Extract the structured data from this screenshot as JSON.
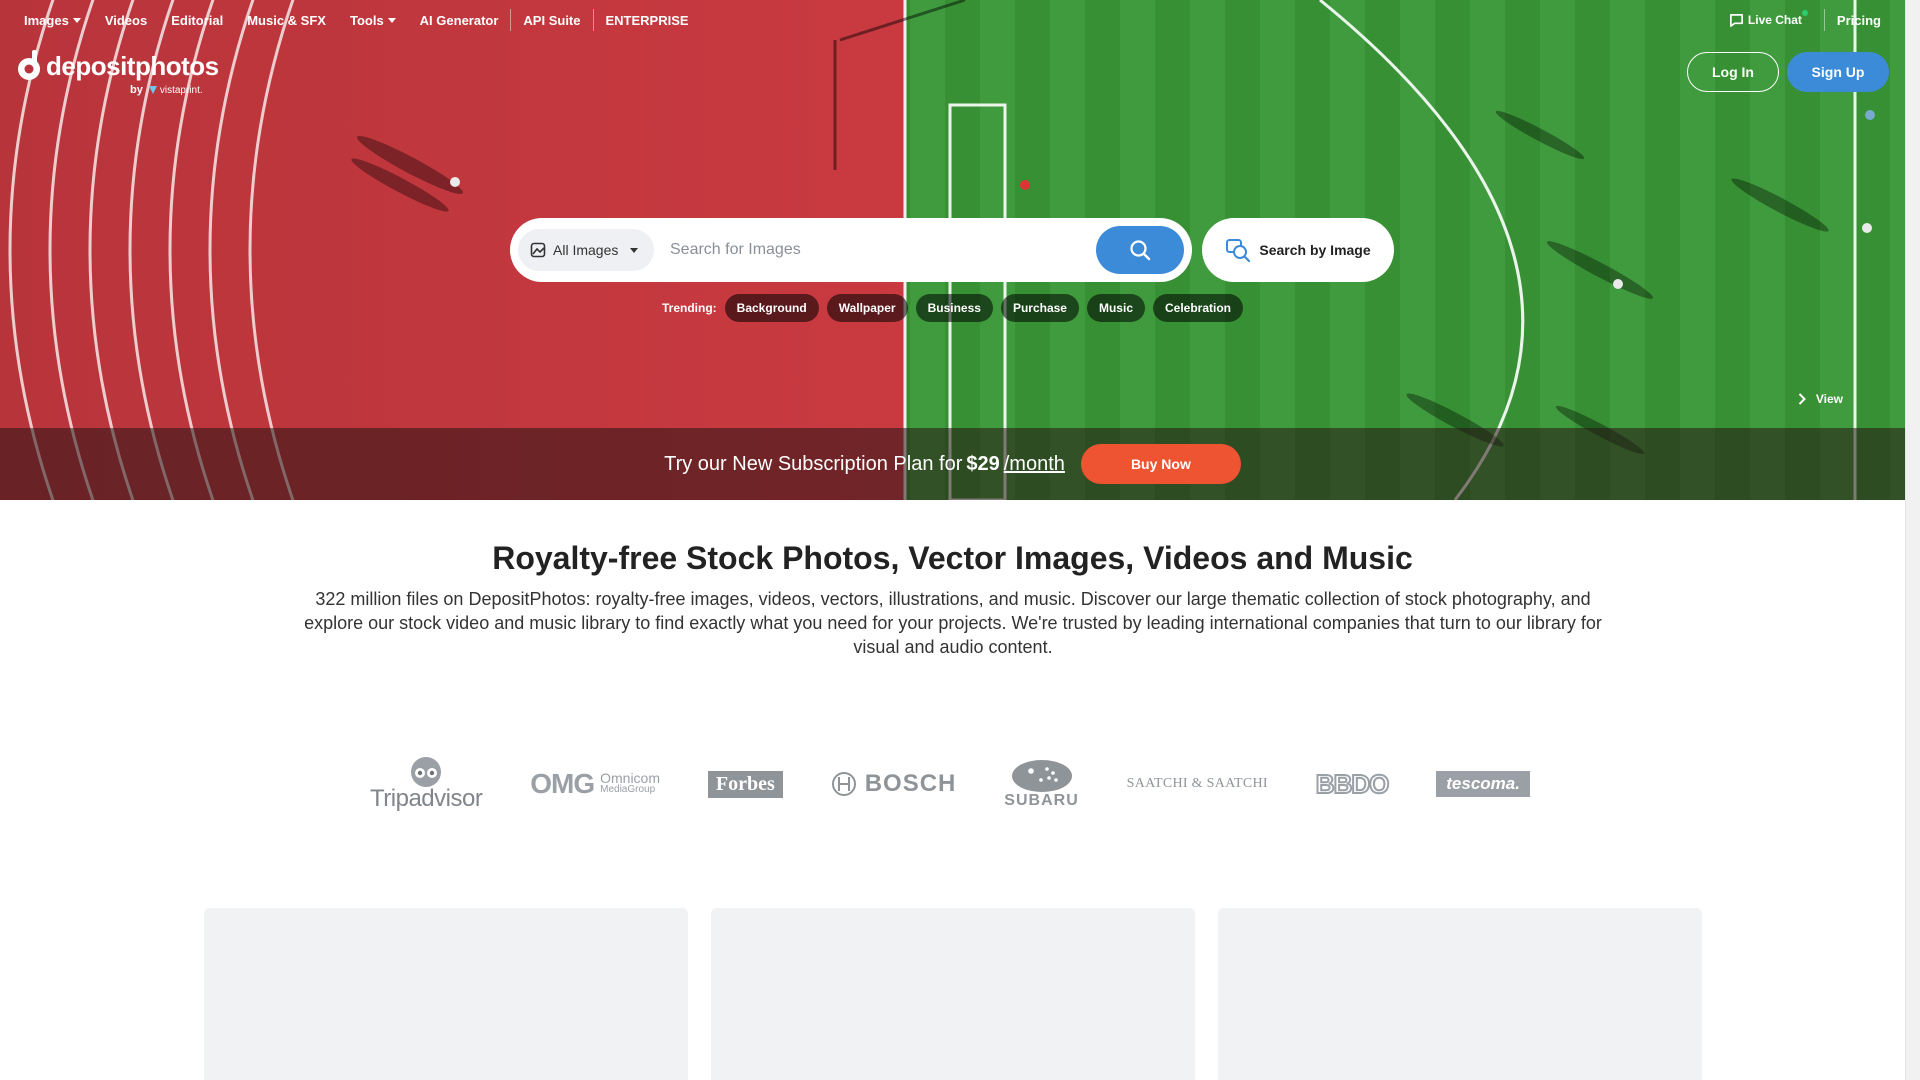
{
  "nav": {
    "items": [
      {
        "label": "Images",
        "dropdown": true
      },
      {
        "label": "Videos",
        "dropdown": false
      },
      {
        "label": "Editorial",
        "dropdown": false
      },
      {
        "label": "Music & SFX",
        "dropdown": false
      },
      {
        "label": "Tools",
        "dropdown": true
      },
      {
        "label": "AI Generator",
        "dropdown": false
      },
      {
        "label": "API Suite",
        "dropdown": false
      },
      {
        "label": "ENTERPRISE",
        "dropdown": false
      }
    ],
    "live_chat": "Live Chat",
    "pricing": "Pricing"
  },
  "logo": {
    "brand": "depositphotos",
    "by": "by",
    "partner": "vistaprint."
  },
  "auth": {
    "login": "Log In",
    "signup": "Sign Up"
  },
  "search": {
    "type_label": "All Images",
    "placeholder": "Search for Images",
    "by_image": "Search by Image"
  },
  "trending": {
    "label": "Trending:",
    "chips": [
      "Background",
      "Wallpaper",
      "Business",
      "Purchase",
      "Music",
      "Celebration"
    ]
  },
  "hero": {
    "view_label": "View"
  },
  "promo": {
    "text": "Try our New Subscription Plan for",
    "price": "$29",
    "period": "/month",
    "button": "Buy Now"
  },
  "content": {
    "headline": "Royalty-free Stock Photos, Vector Images, Videos and Music",
    "description": "322 million files on DepositPhotos: royalty-free images, videos, vectors, illustrations, and music. Discover our large thematic collection of stock photography, and explore our stock video and music library to find exactly what you need for your projects. We're trusted by leading international companies that turn to our library for visual and audio content."
  },
  "clients": {
    "tripadvisor": "Tripadvisor",
    "omg": "OMG",
    "omg_sub1": "Omnicom",
    "omg_sub2": "MediaGroup",
    "forbes": "Forbes",
    "bosch": "BOSCH",
    "subaru": "SUBARU",
    "saatchi": "SAATCHI & SAATCHI",
    "bbdo": "BBDO",
    "tescoma": "tescoma."
  },
  "colors": {
    "accent_blue": "#3b8bd9",
    "buy_orange": "#ef5432",
    "track_red": "#c2343c",
    "field_green": "#3d9a3c"
  }
}
